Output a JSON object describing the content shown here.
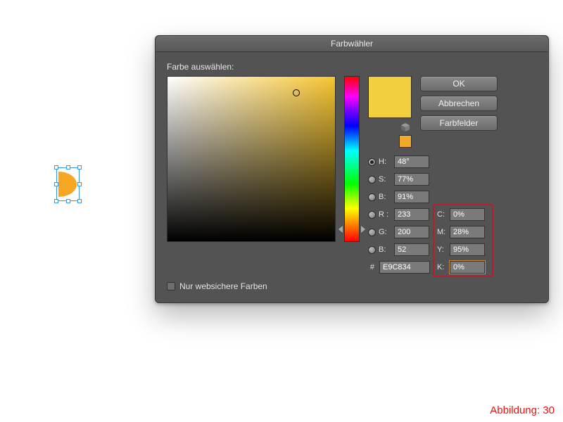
{
  "dialog": {
    "title": "Farbwähler",
    "prompt": "Farbe auswählen:",
    "buttons": {
      "ok": "OK",
      "cancel": "Abbrechen",
      "swatches": "Farbfelder"
    },
    "websafe_label": "Nur websichere Farben"
  },
  "color": {
    "hsb": {
      "h_label": "H:",
      "s_label": "S:",
      "b_label": "B:",
      "h": "48°",
      "s": "77%",
      "b": "91%"
    },
    "rgb": {
      "r_label": "R :",
      "g_label": "G:",
      "b_label": "B:",
      "r": "233",
      "g": "200",
      "b": "52"
    },
    "cmyk": {
      "c_label": "C:",
      "m_label": "M:",
      "y_label": "Y:",
      "k_label": "K:",
      "c": "0%",
      "m": "28%",
      "y": "95%",
      "k": "0%"
    },
    "hex_label": "#",
    "hex": "E9C834",
    "preview_hex": "#f2cf3e",
    "mini_swatch_hex": "#f2a92a"
  },
  "caption": "Abbildung: 30"
}
